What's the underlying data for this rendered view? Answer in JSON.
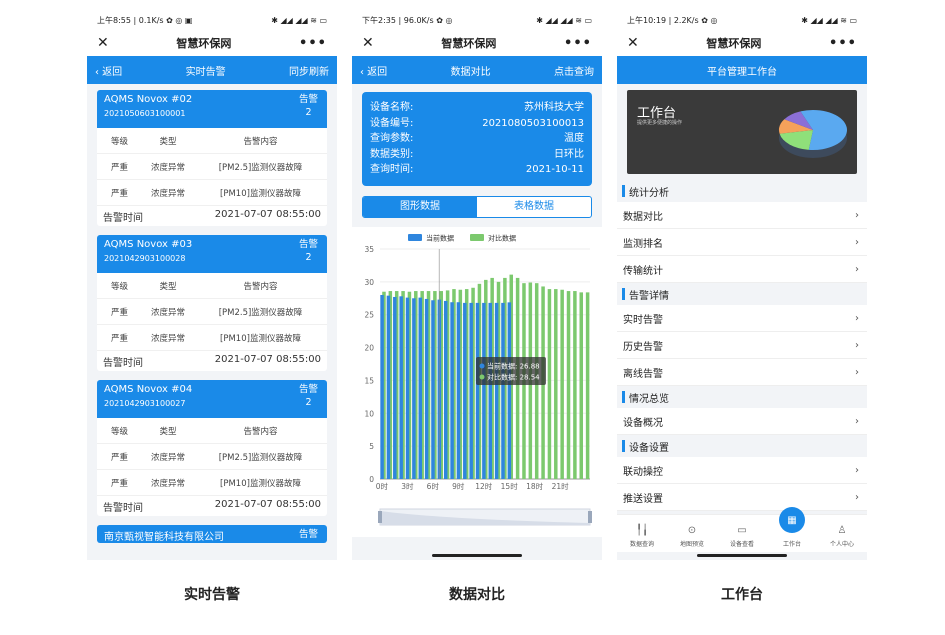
{
  "common": {
    "app_title": "智慧环保网",
    "close_glyph": "✕",
    "more_glyph": "•••",
    "status_icons": "✱ ◢◢ ◢◢ ≋ ▭"
  },
  "phone1": {
    "status_time": "上午8:55 | 0.1K/s ✿ ◎ ▣",
    "back": "‹ 返回",
    "title": "实时告警",
    "action": "同步刷新",
    "columns": [
      "等级",
      "类型",
      "告警内容"
    ],
    "cards": [
      {
        "name": "AQMS Novox #02",
        "code": "2021050603100001",
        "badge_label": "告警",
        "badge_count": "2",
        "rows": [
          [
            "严重",
            "浓度异常",
            "[PM2.5]监测仪器故障"
          ],
          [
            "严重",
            "浓度异常",
            "[PM10]监测仪器故障"
          ]
        ],
        "time_label": "告警时间",
        "time_value": "2021-07-07 08:55:00"
      },
      {
        "name": "AQMS Novox #03",
        "code": "2021042903100028",
        "badge_label": "告警",
        "badge_count": "2",
        "rows": [
          [
            "严重",
            "浓度异常",
            "[PM2.5]监测仪器故障"
          ],
          [
            "严重",
            "浓度异常",
            "[PM10]监测仪器故障"
          ]
        ],
        "time_label": "告警时间",
        "time_value": "2021-07-07 08:55:00"
      },
      {
        "name": "AQMS Novox #04",
        "code": "2021042903100027",
        "badge_label": "告警",
        "badge_count": "2",
        "rows": [
          [
            "严重",
            "浓度异常",
            "[PM2.5]监测仪器故障"
          ],
          [
            "严重",
            "浓度异常",
            "[PM10]监测仪器故障"
          ]
        ],
        "time_label": "告警时间",
        "time_value": "2021-07-07 08:55:00"
      }
    ],
    "partial_card": {
      "name": "南京甄视智能科技有限公司",
      "badge_label": "告警"
    },
    "caption": "实时告警"
  },
  "phone2": {
    "status_time": "下午2:35 | 96.0K/s ✿ ◎",
    "back": "‹ 返回",
    "title": "数据对比",
    "action": "点击查询",
    "info": [
      {
        "label": "设备名称:",
        "value": "苏州科技大学"
      },
      {
        "label": "设备编号:",
        "value": "2021080503100013"
      },
      {
        "label": "查询参数:",
        "value": "温度"
      },
      {
        "label": "数据类别:",
        "value": "日环比"
      },
      {
        "label": "查询时间:",
        "value": "2021-10-11"
      }
    ],
    "seg_on": "图形数据",
    "seg_off": "表格数据",
    "tooltip": {
      "line1": "当前数据: 26.88",
      "line2": "对比数据: 28.54"
    },
    "caption": "数据对比"
  },
  "chart_data": {
    "type": "bar",
    "series": [
      {
        "name": "当前数据",
        "color": "#2f86de",
        "values": [
          28.0,
          27.9,
          27.7,
          27.8,
          27.6,
          27.5,
          27.6,
          27.4,
          27.2,
          27.3,
          27.1,
          26.9,
          26.9,
          26.8,
          26.8,
          26.8,
          26.8,
          26.8,
          26.8,
          26.8,
          26.88
        ]
      },
      {
        "name": "对比数据",
        "color": "#7cc96e",
        "values": [
          28.5,
          28.6,
          28.6,
          28.6,
          28.5,
          28.6,
          28.6,
          28.6,
          28.6,
          28.6,
          28.7,
          28.9,
          28.8,
          28.9,
          29.1,
          29.7,
          30.3,
          30.6,
          30.0,
          30.6,
          31.1,
          30.6,
          29.8,
          29.9,
          29.8,
          29.3,
          28.9,
          28.9,
          28.8,
          28.6,
          28.6,
          28.4,
          28.4
        ]
      }
    ],
    "x_ticks": [
      "0时",
      "3时",
      "6时",
      "9时",
      "12时",
      "15时",
      "18时",
      "21时"
    ],
    "y_ticks": [
      "0",
      "5",
      "10",
      "15",
      "20",
      "25",
      "30",
      "35"
    ],
    "ylim": [
      0,
      35
    ],
    "grid": true,
    "legend_position": "top-center"
  },
  "phone3": {
    "status_time": "上午10:19 | 2.2K/s ✿ ◎",
    "header": "平台管理工作台",
    "hero_title": "工作台",
    "hero_sub": "提供更多便捷的操作",
    "pie_colors": [
      "#5aa9f0",
      "#3d4a5c",
      "#8fe07a",
      "#f5a15a",
      "#8b6fd6"
    ],
    "sections": [
      {
        "title": "统计分析",
        "items": [
          "数据对比",
          "监测排名",
          "传输统计"
        ]
      },
      {
        "title": "告警详情",
        "items": [
          "实时告警",
          "历史告警",
          "离线告警"
        ]
      },
      {
        "title": "情况总览",
        "items": [
          "设备概况"
        ]
      },
      {
        "title": "设备设置",
        "items": [
          "联动操控",
          "推送设置"
        ]
      }
    ],
    "tabs": [
      {
        "icon": "╿╽",
        "label": "数据查询"
      },
      {
        "icon": "⊙",
        "label": "地图预览"
      },
      {
        "icon": "▭",
        "label": "设备查看"
      },
      {
        "icon": "▦",
        "label": "工作台"
      },
      {
        "icon": "♙",
        "label": "个人中心"
      }
    ],
    "caption": "工作台"
  }
}
